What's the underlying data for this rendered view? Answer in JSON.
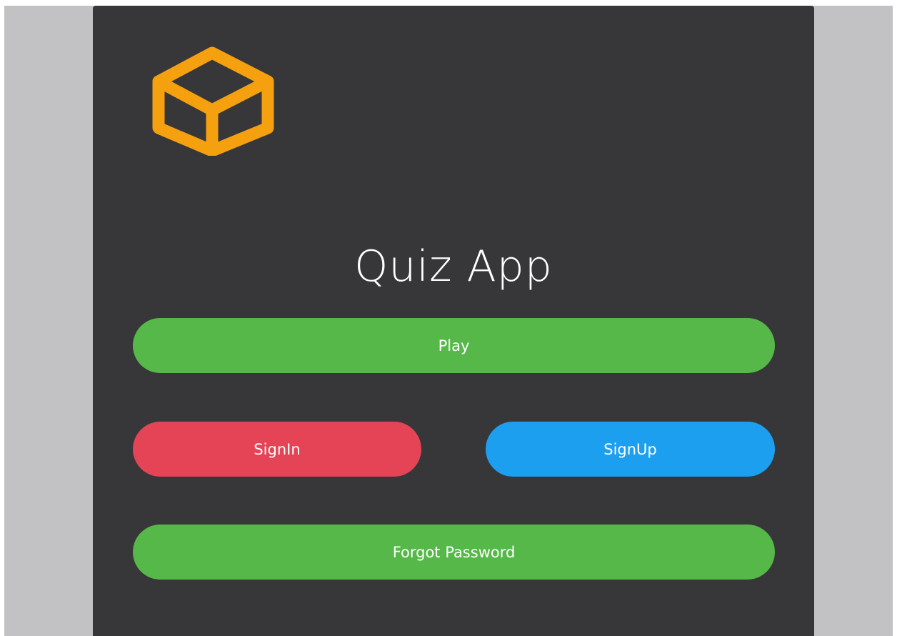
{
  "app": {
    "title": "Quiz App",
    "logo_icon": "cube-icon",
    "logo_color": "#f5a00f"
  },
  "buttons": {
    "play": {
      "label": "Play",
      "color": "#57b84a"
    },
    "signin": {
      "label": "SignIn",
      "color": "#e54456"
    },
    "signup": {
      "label": "SignUp",
      "color": "#1d9ff0"
    },
    "forgot": {
      "label": "Forgot Password",
      "color": "#57b84a"
    }
  },
  "theme": {
    "panel_bg": "#373739",
    "page_bg": "#c2c2c4",
    "text": "#ffffff"
  }
}
